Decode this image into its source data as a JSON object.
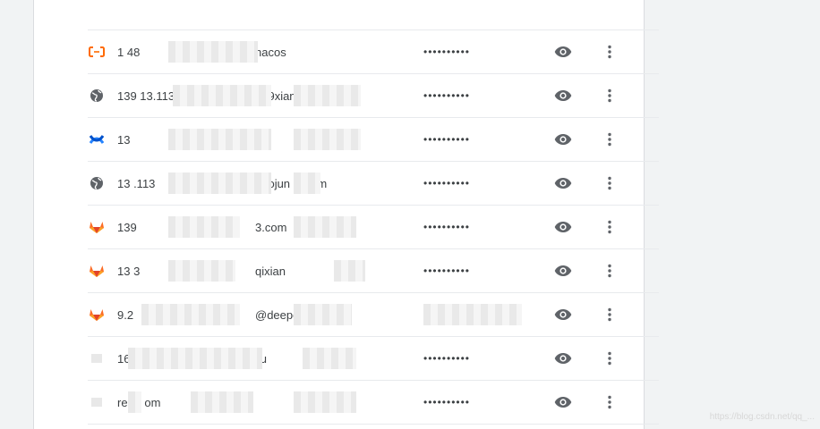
{
  "rows": [
    {
      "icon": "alibaba-cloud-icon",
      "site": "1            48",
      "user": "nacos",
      "password": "••••••••••"
    },
    {
      "icon": "globe-icon",
      "site": "139        13.113",
      "user": "      329xiang",
      "password": "••••••••••"
    },
    {
      "icon": "confluence-icon",
      "site": "13",
      "user": "",
      "password": "••••••••••"
    },
    {
      "icon": "globe-icon",
      "site": "13        .113",
      "user": "   guojun        ki.com",
      "password": "••••••••••"
    },
    {
      "icon": "gitlab-icon",
      "site": "139",
      "user": "                  3.com",
      "password": "••••••••••"
    },
    {
      "icon": "gitlab-icon",
      "site": "13              3",
      "user": "qixian",
      "password": "••••••••••"
    },
    {
      "icon": "gitlab-icon",
      "site": "  9.2",
      "user": "              @deepexi",
      "password": "••••••••••"
    },
    {
      "icon": "blank-icon",
      "site": "                 163",
      "user": "liu",
      "password": "••••••••••"
    },
    {
      "icon": "blank-icon",
      "site": "reg.r              om",
      "user": "",
      "password": "••••••••••"
    }
  ],
  "actions": {
    "show_password_label": "Show password",
    "more_actions_label": "More actions"
  },
  "watermark": "https://blog.csdn.net/qq_..."
}
